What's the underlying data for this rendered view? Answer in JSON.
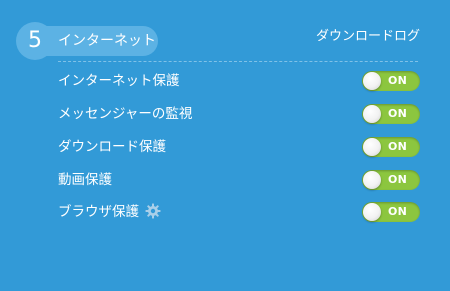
{
  "section": {
    "number": "5",
    "title": "インターネット",
    "link_label": "ダウンロードログ"
  },
  "settings": [
    {
      "label": "インターネット保護",
      "state": "ON",
      "enabled": true,
      "has_gear": false
    },
    {
      "label": "メッセンジャーの監視",
      "state": "ON",
      "enabled": true,
      "has_gear": false
    },
    {
      "label": "ダウンロード保護",
      "state": "ON",
      "enabled": true,
      "has_gear": false
    },
    {
      "label": "動画保護",
      "state": "ON",
      "enabled": true,
      "has_gear": false
    },
    {
      "label": "ブラウザ保護",
      "state": "ON",
      "enabled": true,
      "has_gear": true,
      "gear_icon": "gear-icon"
    }
  ],
  "colors": {
    "background": "#329ad7",
    "toggle_on": "#8cc63f",
    "pill": "#5cb2e4"
  }
}
